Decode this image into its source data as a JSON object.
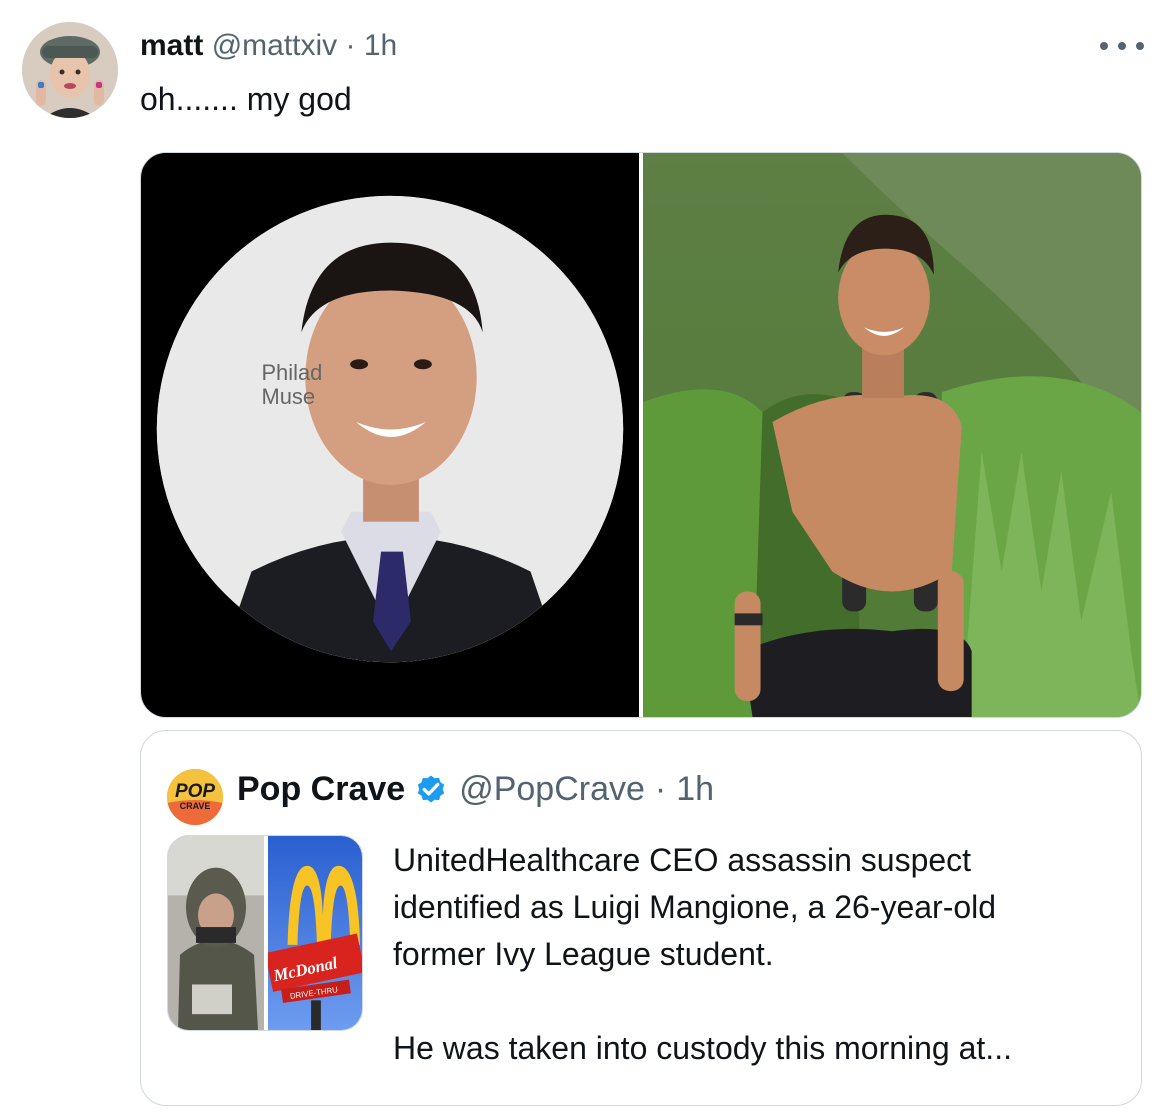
{
  "tweet": {
    "author_name": "matt",
    "author_handle": "@mattxiv",
    "separator": "·",
    "time": "1h",
    "text": "oh....... my god",
    "more_icon": "more-horizontal-icon"
  },
  "media": {
    "image_left_text_line1": "Philad",
    "image_left_text_line2": "Muse"
  },
  "quote": {
    "logo_text_line1": "POP",
    "logo_text_line2": "CRAVE",
    "author_name": "Pop Crave",
    "verified_icon": "verified-badge-icon",
    "author_handle": "@PopCrave",
    "separator": "·",
    "time": "1h",
    "text_line1": "UnitedHealthcare CEO assassin suspect",
    "text_line2": "identified as Luigi Mangione, a 26-year-old",
    "text_line3": "former Ivy League student.",
    "text_line4": "He was taken into custody this morning at...",
    "thumb_sign_text": "McDonal",
    "thumb_sign_sub": "DRIVE-THRU"
  },
  "colors": {
    "text_primary": "#0f1419",
    "text_secondary": "#536471",
    "border": "#cfd9de",
    "verified_blue": "#1d9bf0",
    "popcrave_yellow": "#f4c23e"
  }
}
